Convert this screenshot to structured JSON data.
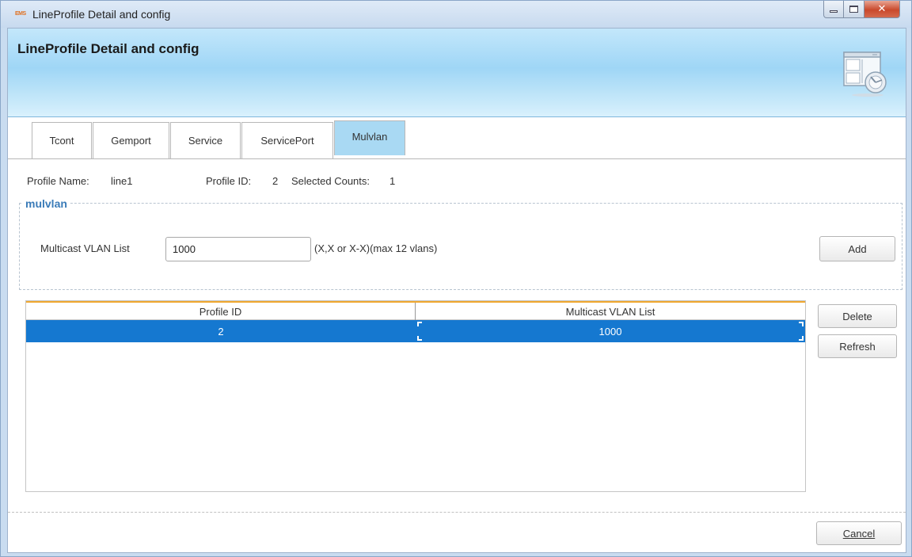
{
  "window": {
    "title": "LineProfile Detail and config",
    "app_icon_text": "EMS"
  },
  "banner": {
    "title": "LineProfile Detail and config"
  },
  "tabs": [
    {
      "label": "Tcont",
      "active": false
    },
    {
      "label": "Gemport",
      "active": false
    },
    {
      "label": "Service",
      "active": false
    },
    {
      "label": "ServicePort",
      "active": false
    },
    {
      "label": "Mulvlan",
      "active": true
    }
  ],
  "profile": {
    "name_label": "Profile Name:",
    "name_value": "line1",
    "id_label": "Profile ID:",
    "id_value": "2",
    "counts_label": "Selected Counts:",
    "counts_value": "1"
  },
  "group": {
    "legend": "mulvlan",
    "field_label": "Multicast VLAN List",
    "field_value": "1000",
    "field_hint": "(X,X or X-X)(max 12 vlans)",
    "add_label": "Add"
  },
  "table": {
    "columns": [
      "Profile ID",
      "Multicast VLAN List"
    ],
    "rows": [
      {
        "profile_id": "2",
        "vlan_list": "1000",
        "selected": true
      }
    ]
  },
  "side_buttons": {
    "delete_label": "Delete",
    "refresh_label": "Refresh"
  },
  "footer": {
    "cancel_label": "Cancel"
  },
  "colors": {
    "selection": "#1578d0",
    "banner": "#a9d9f3",
    "active_tab": "#a9d9f3",
    "value_text": "#1f3fb8",
    "legend_text": "#3a7bb8",
    "header_accent": "#f0a830"
  }
}
